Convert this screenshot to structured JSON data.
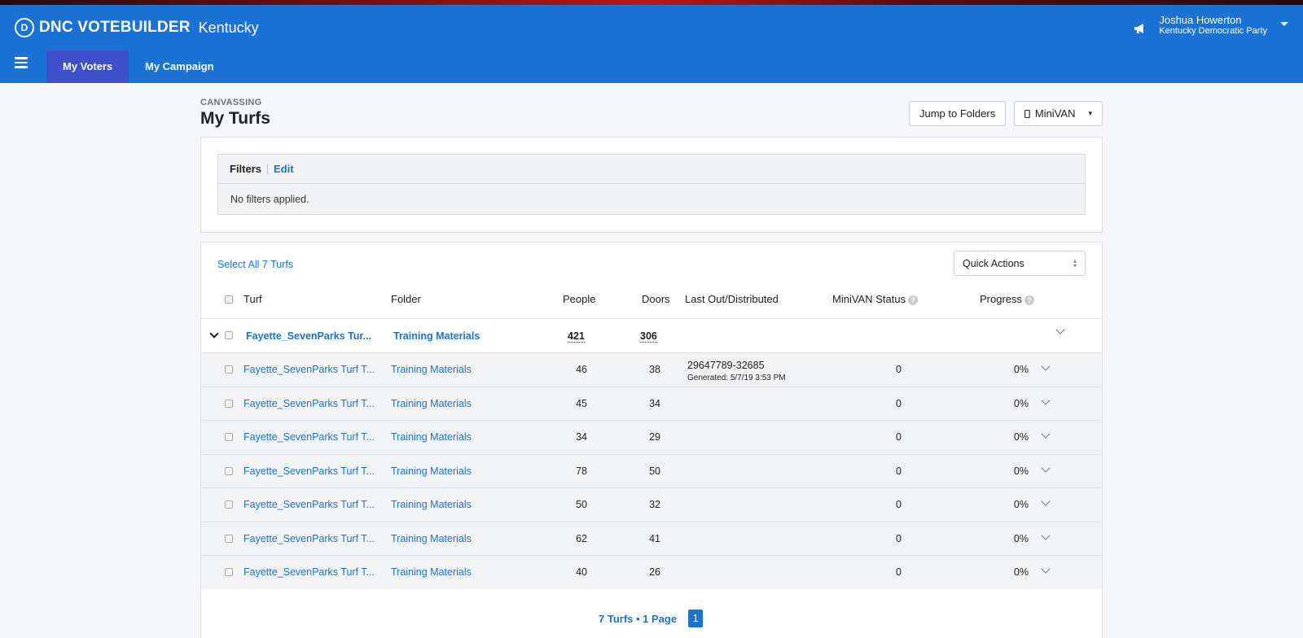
{
  "header": {
    "logo_letter": "D",
    "brand": "DNC VOTEBUILDER",
    "state": "Kentucky",
    "user_name": "Joshua Howerton",
    "user_org": "Kentucky Democratic Party",
    "tabs": [
      {
        "label": "My Voters",
        "active": true
      },
      {
        "label": "My Campaign",
        "active": false
      }
    ]
  },
  "page": {
    "overline": "CANVASSING",
    "title": "My Turfs",
    "jump_label": "Jump to Folders",
    "minivan_label": "MiniVAN",
    "minivan_caret": "▾"
  },
  "filters": {
    "label": "Filters",
    "edit_label": "Edit",
    "body": "No filters applied."
  },
  "table": {
    "select_all": "Select All 7 Turfs",
    "quick_actions": "Quick Actions",
    "columns": {
      "turf": "Turf",
      "folder": "Folder",
      "people": "People",
      "doors": "Doors",
      "last_out": "Last Out/Distributed",
      "minivan_status": "MiniVAN Status",
      "progress": "Progress"
    },
    "help_glyph": "?",
    "parent": {
      "turf": "Fayette_SevenParks Tur...",
      "folder": "Training Materials",
      "people": "421",
      "doors": "306"
    },
    "rows": [
      {
        "turf": "Fayette_SevenParks Turf T...",
        "folder": "Training Materials",
        "people": "46",
        "doors": "38",
        "last_out": "29647789-32685",
        "generated": "Generated: 5/7/19 3:53 PM",
        "minivan": "0",
        "progress": "0%"
      },
      {
        "turf": "Fayette_SevenParks Turf T...",
        "folder": "Training Materials",
        "people": "45",
        "doors": "34",
        "last_out": "",
        "generated": "",
        "minivan": "0",
        "progress": "0%"
      },
      {
        "turf": "Fayette_SevenParks Turf T...",
        "folder": "Training Materials",
        "people": "34",
        "doors": "29",
        "last_out": "",
        "generated": "",
        "minivan": "0",
        "progress": "0%"
      },
      {
        "turf": "Fayette_SevenParks Turf T...",
        "folder": "Training Materials",
        "people": "78",
        "doors": "50",
        "last_out": "",
        "generated": "",
        "minivan": "0",
        "progress": "0%"
      },
      {
        "turf": "Fayette_SevenParks Turf T...",
        "folder": "Training Materials",
        "people": "50",
        "doors": "32",
        "last_out": "",
        "generated": "",
        "minivan": "0",
        "progress": "0%"
      },
      {
        "turf": "Fayette_SevenParks Turf T...",
        "folder": "Training Materials",
        "people": "62",
        "doors": "41",
        "last_out": "",
        "generated": "",
        "minivan": "0",
        "progress": "0%"
      },
      {
        "turf": "Fayette_SevenParks Turf T...",
        "folder": "Training Materials",
        "people": "40",
        "doors": "26",
        "last_out": "",
        "generated": "",
        "minivan": "0",
        "progress": "0%"
      }
    ]
  },
  "pager": {
    "summary": "7 Turfs • 1 Page",
    "current_page": "1"
  },
  "colors": {
    "header": "#1a73d4",
    "active_tab": "#3f4fcb",
    "link": "#1a73d4"
  }
}
